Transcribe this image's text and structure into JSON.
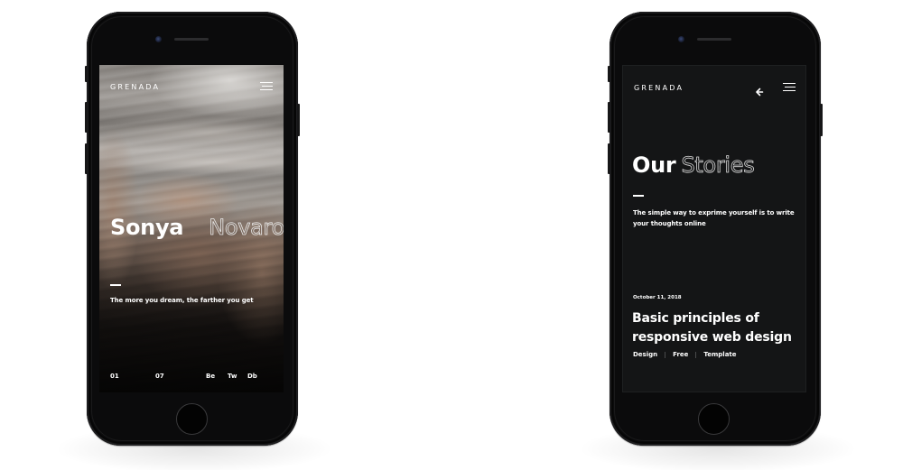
{
  "phones": [
    {
      "screen": "hero",
      "brand": "GRENADA",
      "hero": {
        "first_name": "Sonya",
        "last_name": "Novaro",
        "tagline": "The more you dream, the farther you get"
      },
      "footer": {
        "current_slide": "01",
        "total_slides": "07",
        "social_links": [
          "Be",
          "Tw",
          "Db"
        ]
      },
      "icons": {
        "menu": "hamburger-menu-icon"
      }
    },
    {
      "screen": "stories",
      "brand": "GRENADA",
      "page": {
        "title_solid": "Our",
        "title_outline": "Stories",
        "description": "The simple way to exprime yourself is to write your thoughts online"
      },
      "post": {
        "date": "October 11, 2018",
        "title": "Basic principles of responsive web design",
        "tags": [
          "Design",
          "Free",
          "Template"
        ]
      },
      "icons": {
        "back": "arrow-left-icon",
        "menu": "hamburger-menu-icon"
      },
      "colors": {
        "screen_background": "#141516",
        "text": "#ffffff"
      }
    }
  ]
}
